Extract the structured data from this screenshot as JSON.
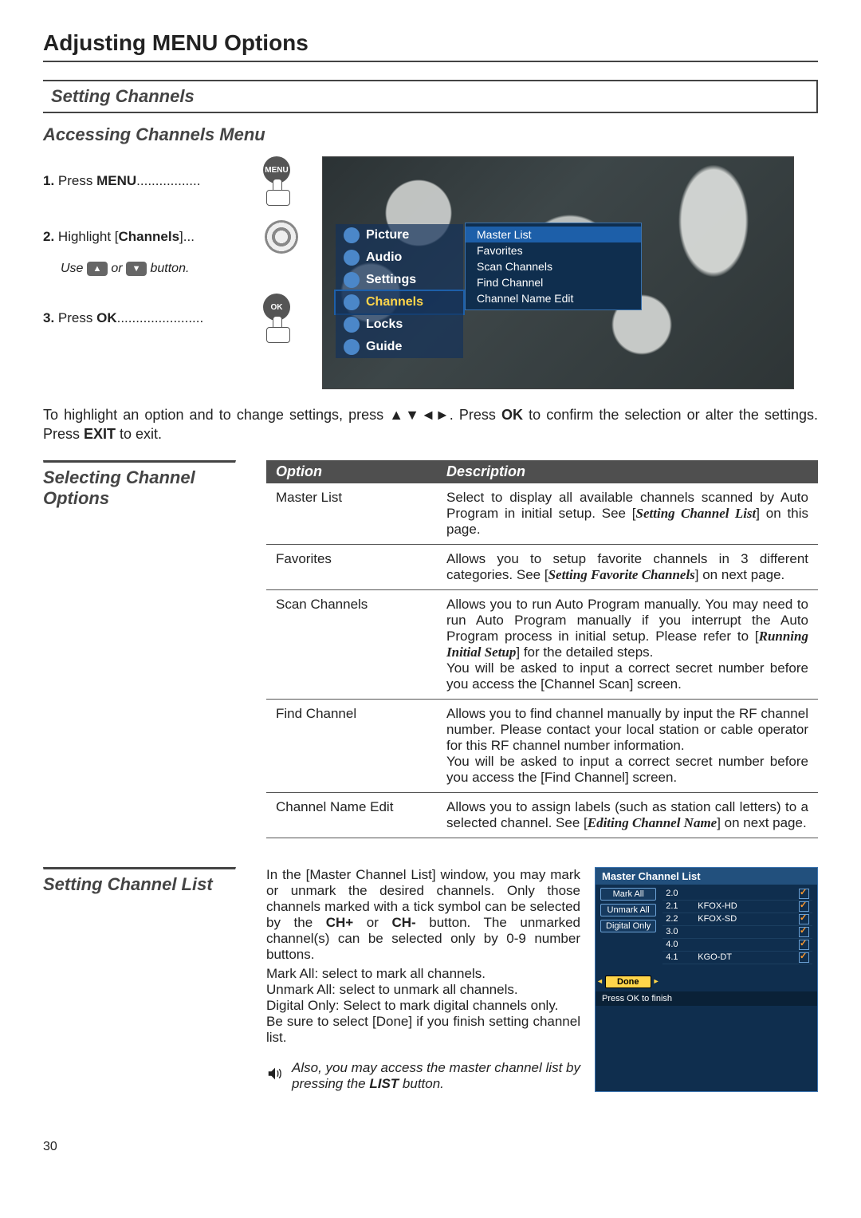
{
  "page": {
    "number": "30"
  },
  "title": "Adjusting MENU Options",
  "section_bar": "Setting Channels",
  "subtitle": "Accessing Channels Menu",
  "steps": {
    "s1_prefix": "1.",
    "s1_text": " Press ",
    "s1_bold": "MENU",
    "s1_dots": ".................",
    "s1_cap": "MENU",
    "s2_prefix": "2.",
    "s2_text": " Highlight [",
    "s2_bold": "Channels",
    "s2_suffix": "]...",
    "use_line_pre": "Use ",
    "use_line_mid": " or ",
    "use_line_post": " button.",
    "s3_prefix": "3.",
    "s3_text": " Press ",
    "s3_bold": "OK",
    "s3_dots": ".......................",
    "s3_cap": "OK"
  },
  "osd": {
    "tabs": [
      "Picture",
      "Audio",
      "Settings",
      "Channels",
      "Locks",
      "Guide"
    ],
    "active_index": 3,
    "sub": [
      "Master List",
      "Favorites",
      "Scan Channels",
      "Find Channel",
      "Channel Name Edit"
    ]
  },
  "para1_a": "To highlight an option and to change settings, press ▲▼◄►. Press ",
  "para1_b": "OK",
  "para1_c": " to confirm the selection or alter the settings. Press ",
  "para1_d": "EXIT",
  "para1_e": " to exit.",
  "select_label": "Selecting Channel Options",
  "opt_head": {
    "c1": "Option",
    "c2": "Description"
  },
  "options": [
    {
      "name": "Master List",
      "desc_a": "Select to display all available channels scanned by Auto Program in initial setup. See [",
      "ref": "Setting Channel List",
      "desc_b": "] on this page."
    },
    {
      "name": "Favorites",
      "desc_a": "Allows you to setup favorite channels in 3 different categories. See [",
      "ref": "Setting Favorite Channels",
      "desc_b": "] on next page."
    },
    {
      "name": "Scan Channels",
      "desc_a": "Allows you to run Auto Program manually. You may need to run Auto Program manually if you interrupt the Auto Program process in initial setup. Please refer to [",
      "ref": "Running Initial Setup",
      "desc_b": "] for the detailed steps.",
      "extra": "You will be asked to input a correct secret number before you access the [Channel Scan] screen."
    },
    {
      "name": "Find Channel",
      "desc_a": "Allows you to find channel manually by input the RF channel number. Please contact your local station or cable operator for this RF channel number information.",
      "extra": "You will be asked to input a correct secret number before you access the [Find Channel] screen."
    },
    {
      "name": "Channel Name Edit",
      "desc_a": "Allows you to assign labels (such as station call letters) to a selected channel. See [",
      "ref": "Editing Channel Name",
      "desc_b": "] on next page."
    }
  ],
  "scl_label": "Setting Channel List",
  "scl_text_a": "In the [Master Channel List] window, you may mark or unmark the desired channels. Only those channels marked with a tick symbol can be selected by the ",
  "scl_text_b1": "CH+",
  "scl_text_mid": " or ",
  "scl_text_b2": "CH-",
  "scl_text_c": " button. The unmarked channel(s) can be selected only by 0-9 number buttons.",
  "scl_lines": [
    "Mark All: select to mark all channels.",
    "Unmark All: select to unmark all channels.",
    "Digital Only: Select to mark digital channels only.",
    "Be sure to select [Done] if you finish setting channel list."
  ],
  "mcl": {
    "title": "Master Channel List",
    "buttons": [
      "Mark All",
      "Unmark All",
      "Digital Only"
    ],
    "done": "Done",
    "rows": [
      {
        "ch": "2.0",
        "name": ""
      },
      {
        "ch": "2.1",
        "name": "KFOX-HD"
      },
      {
        "ch": "2.2",
        "name": "KFOX-SD"
      },
      {
        "ch": "3.0",
        "name": ""
      },
      {
        "ch": "4.0",
        "name": ""
      },
      {
        "ch": "4.1",
        "name": "KGO-DT"
      }
    ],
    "footer": "Press OK to finish"
  },
  "note_a": "Also, you may access the master channel list by pressing  the ",
  "note_b": "LIST",
  "note_c": " button."
}
